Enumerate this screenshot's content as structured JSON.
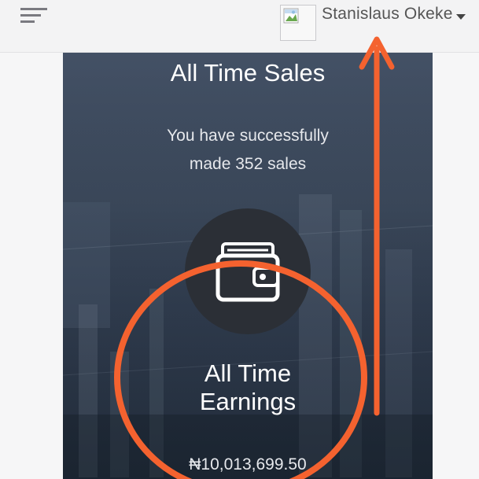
{
  "header": {
    "menu_icon": "hamburger-menu-icon",
    "avatar_icon": "broken-image-icon",
    "user_name": "Stanislaus Okeke",
    "dropdown_icon": "caret-down-icon"
  },
  "card": {
    "title": "All Time Sales",
    "subtitle_line1": "You have successfully",
    "subtitle_line2": "made 352 sales",
    "wallet_icon": "wallet-icon",
    "earnings_title_line1": "All Time",
    "earnings_title_line2": "Earnings",
    "earnings_value": "₦10,013,699.50"
  },
  "annotation": {
    "color": "#f4622f",
    "shapes": [
      "circle",
      "arrow-up"
    ]
  },
  "colors": {
    "header_bg": "#f3f3f4",
    "card_bg": "#3a4759",
    "accent": "#f4622f"
  }
}
